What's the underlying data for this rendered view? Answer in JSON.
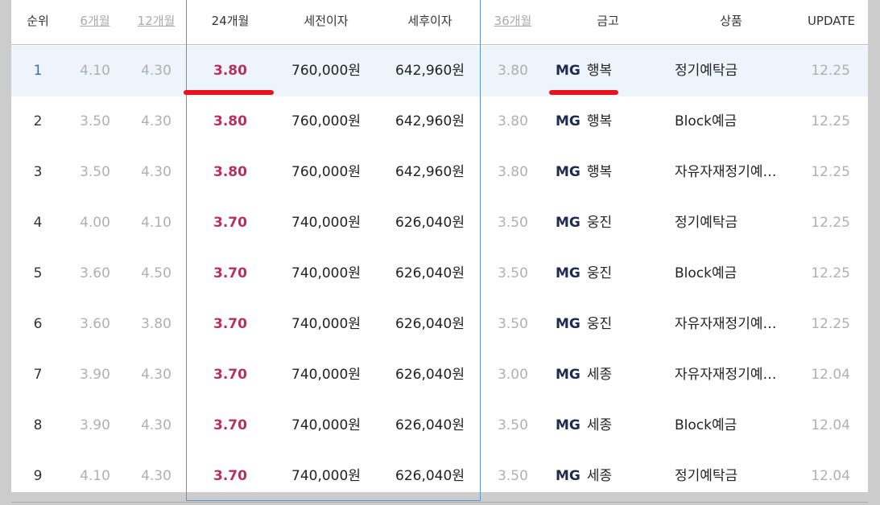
{
  "header": {
    "rank": "순위",
    "m6": "6개월",
    "m12": "12개월",
    "m24": "24개월",
    "pretax": "세전이자",
    "aftertax": "세후이자",
    "m36": "36개월",
    "bank": "금고",
    "product": "상품",
    "update": "UPDATE"
  },
  "rows": [
    {
      "rank": "1",
      "m6": "4.10",
      "m12": "4.30",
      "m24": "3.80",
      "pretax": "760,000원",
      "aftertax": "642,960원",
      "m36": "3.80",
      "bank_prefix": "MG",
      "bank_name": "행복",
      "product": "정기예탁금",
      "update": "12.25"
    },
    {
      "rank": "2",
      "m6": "3.50",
      "m12": "4.30",
      "m24": "3.80",
      "pretax": "760,000원",
      "aftertax": "642,960원",
      "m36": "3.80",
      "bank_prefix": "MG",
      "bank_name": "행복",
      "product": "Block예금",
      "update": "12.25"
    },
    {
      "rank": "3",
      "m6": "3.50",
      "m12": "4.30",
      "m24": "3.80",
      "pretax": "760,000원",
      "aftertax": "642,960원",
      "m36": "3.80",
      "bank_prefix": "MG",
      "bank_name": "행복",
      "product": "자유자재정기예…",
      "update": "12.25"
    },
    {
      "rank": "4",
      "m6": "4.00",
      "m12": "4.10",
      "m24": "3.70",
      "pretax": "740,000원",
      "aftertax": "626,040원",
      "m36": "3.50",
      "bank_prefix": "MG",
      "bank_name": "웅진",
      "product": "정기예탁금",
      "update": "12.25"
    },
    {
      "rank": "5",
      "m6": "3.60",
      "m12": "4.50",
      "m24": "3.70",
      "pretax": "740,000원",
      "aftertax": "626,040원",
      "m36": "3.50",
      "bank_prefix": "MG",
      "bank_name": "웅진",
      "product": "Block예금",
      "update": "12.25"
    },
    {
      "rank": "6",
      "m6": "3.60",
      "m12": "3.80",
      "m24": "3.70",
      "pretax": "740,000원",
      "aftertax": "626,040원",
      "m36": "3.50",
      "bank_prefix": "MG",
      "bank_name": "웅진",
      "product": "자유자재정기예…",
      "update": "12.25"
    },
    {
      "rank": "7",
      "m6": "3.90",
      "m12": "4.30",
      "m24": "3.70",
      "pretax": "740,000원",
      "aftertax": "626,040원",
      "m36": "3.00",
      "bank_prefix": "MG",
      "bank_name": "세종",
      "product": "자유자재정기예…",
      "update": "12.04"
    },
    {
      "rank": "8",
      "m6": "3.90",
      "m12": "4.30",
      "m24": "3.70",
      "pretax": "740,000원",
      "aftertax": "626,040원",
      "m36": "3.50",
      "bank_prefix": "MG",
      "bank_name": "세종",
      "product": "Block예금",
      "update": "12.04"
    },
    {
      "rank": "9",
      "m6": "4.10",
      "m12": "4.30",
      "m24": "3.70",
      "pretax": "740,000원",
      "aftertax": "626,040원",
      "m36": "3.50",
      "bank_prefix": "MG",
      "bank_name": "세종",
      "product": "정기예탁금",
      "update": "12.04"
    }
  ],
  "colors": {
    "highlight_row": "#eef4fc",
    "rate_24m": "#b7305e",
    "box_outline": "#5b93d6",
    "annotation_red": "#e8141b"
  }
}
